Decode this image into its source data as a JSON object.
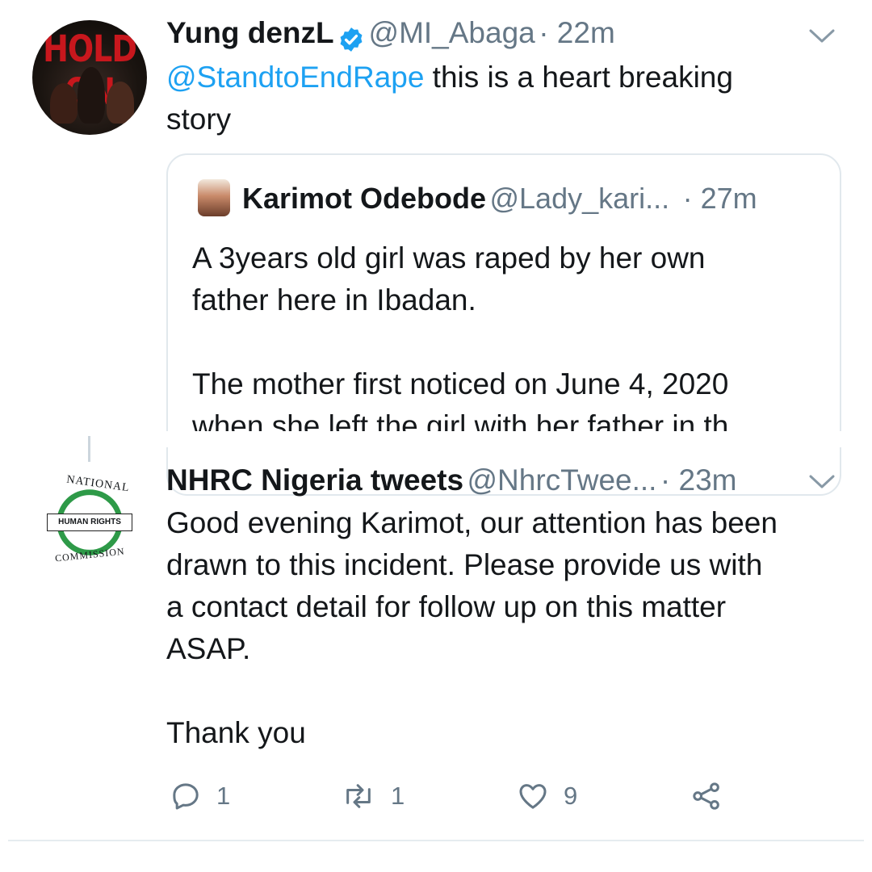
{
  "tweet1": {
    "avatar_text": "HOLD ON",
    "name": "Yung denzL",
    "handle": "@MI_Abaga",
    "time": "· 22m",
    "mention": "@StandtoEndRape",
    "text_after_mention": " this is a heart breaking",
    "text_line2": "story"
  },
  "quote": {
    "name": "Karimot Odebode",
    "handle": "@Lady_kari...",
    "time": "· 27m",
    "lines": [
      "A 3years old girl was raped by her own",
      "father here in Ibadan.",
      "The mother first noticed on June 4, 2020",
      "when she left the girl with her father in th"
    ]
  },
  "tweet2": {
    "name": "NHRC Nigeria tweets",
    "handle": "@NhrcTwee...",
    "time": "· 23m",
    "lines": [
      "Good evening Karimot, our attention has been",
      "drawn to this incident. Please provide us with",
      "a contact detail for follow up on this matter",
      "ASAP.",
      "Thank you"
    ],
    "logo": {
      "top_text": "NATIONAL",
      "center_text": "HUMAN RIGHTS",
      "bottom_text": "COMMISSION"
    },
    "actions": {
      "reply_count": "1",
      "retweet_count": "1",
      "like_count": "9"
    }
  },
  "icons": {
    "verified": "verified-badge-icon",
    "chevron": "chevron-down-icon",
    "reply": "reply-icon",
    "retweet": "retweet-icon",
    "like": "heart-icon",
    "share": "share-icon"
  },
  "colors": {
    "link": "#1da1f2",
    "secondary_text": "#657786",
    "primary_text": "#14171a",
    "logo_green": "#2e9a48"
  }
}
